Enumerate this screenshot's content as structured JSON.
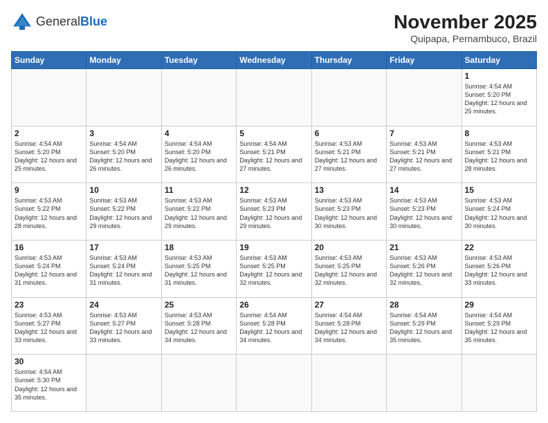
{
  "header": {
    "logo_general": "General",
    "logo_blue": "Blue",
    "month_title": "November 2025",
    "location": "Quipapa, Pernambuco, Brazil"
  },
  "days_of_week": [
    "Sunday",
    "Monday",
    "Tuesday",
    "Wednesday",
    "Thursday",
    "Friday",
    "Saturday"
  ],
  "weeks": [
    [
      {
        "day": "",
        "info": ""
      },
      {
        "day": "",
        "info": ""
      },
      {
        "day": "",
        "info": ""
      },
      {
        "day": "",
        "info": ""
      },
      {
        "day": "",
        "info": ""
      },
      {
        "day": "",
        "info": ""
      },
      {
        "day": "1",
        "info": "Sunrise: 4:54 AM\nSunset: 5:20 PM\nDaylight: 12 hours and 25 minutes."
      }
    ],
    [
      {
        "day": "2",
        "info": "Sunrise: 4:54 AM\nSunset: 5:20 PM\nDaylight: 12 hours and 25 minutes."
      },
      {
        "day": "3",
        "info": "Sunrise: 4:54 AM\nSunset: 5:20 PM\nDaylight: 12 hours and 26 minutes."
      },
      {
        "day": "4",
        "info": "Sunrise: 4:54 AM\nSunset: 5:20 PM\nDaylight: 12 hours and 26 minutes."
      },
      {
        "day": "5",
        "info": "Sunrise: 4:54 AM\nSunset: 5:21 PM\nDaylight: 12 hours and 27 minutes."
      },
      {
        "day": "6",
        "info": "Sunrise: 4:53 AM\nSunset: 5:21 PM\nDaylight: 12 hours and 27 minutes."
      },
      {
        "day": "7",
        "info": "Sunrise: 4:53 AM\nSunset: 5:21 PM\nDaylight: 12 hours and 27 minutes."
      },
      {
        "day": "8",
        "info": "Sunrise: 4:53 AM\nSunset: 5:21 PM\nDaylight: 12 hours and 28 minutes."
      }
    ],
    [
      {
        "day": "9",
        "info": "Sunrise: 4:53 AM\nSunset: 5:22 PM\nDaylight: 12 hours and 28 minutes."
      },
      {
        "day": "10",
        "info": "Sunrise: 4:53 AM\nSunset: 5:22 PM\nDaylight: 12 hours and 29 minutes."
      },
      {
        "day": "11",
        "info": "Sunrise: 4:53 AM\nSunset: 5:22 PM\nDaylight: 12 hours and 29 minutes."
      },
      {
        "day": "12",
        "info": "Sunrise: 4:53 AM\nSunset: 5:23 PM\nDaylight: 12 hours and 29 minutes."
      },
      {
        "day": "13",
        "info": "Sunrise: 4:53 AM\nSunset: 5:23 PM\nDaylight: 12 hours and 30 minutes."
      },
      {
        "day": "14",
        "info": "Sunrise: 4:53 AM\nSunset: 5:23 PM\nDaylight: 12 hours and 30 minutes."
      },
      {
        "day": "15",
        "info": "Sunrise: 4:53 AM\nSunset: 5:24 PM\nDaylight: 12 hours and 30 minutes."
      }
    ],
    [
      {
        "day": "16",
        "info": "Sunrise: 4:53 AM\nSunset: 5:24 PM\nDaylight: 12 hours and 31 minutes."
      },
      {
        "day": "17",
        "info": "Sunrise: 4:53 AM\nSunset: 5:24 PM\nDaylight: 12 hours and 31 minutes."
      },
      {
        "day": "18",
        "info": "Sunrise: 4:53 AM\nSunset: 5:25 PM\nDaylight: 12 hours and 31 minutes."
      },
      {
        "day": "19",
        "info": "Sunrise: 4:53 AM\nSunset: 5:25 PM\nDaylight: 12 hours and 32 minutes."
      },
      {
        "day": "20",
        "info": "Sunrise: 4:53 AM\nSunset: 5:25 PM\nDaylight: 12 hours and 32 minutes."
      },
      {
        "day": "21",
        "info": "Sunrise: 4:53 AM\nSunset: 5:26 PM\nDaylight: 12 hours and 32 minutes."
      },
      {
        "day": "22",
        "info": "Sunrise: 4:53 AM\nSunset: 5:26 PM\nDaylight: 12 hours and 33 minutes."
      }
    ],
    [
      {
        "day": "23",
        "info": "Sunrise: 4:53 AM\nSunset: 5:27 PM\nDaylight: 12 hours and 33 minutes."
      },
      {
        "day": "24",
        "info": "Sunrise: 4:53 AM\nSunset: 5:27 PM\nDaylight: 12 hours and 33 minutes."
      },
      {
        "day": "25",
        "info": "Sunrise: 4:53 AM\nSunset: 5:28 PM\nDaylight: 12 hours and 34 minutes."
      },
      {
        "day": "26",
        "info": "Sunrise: 4:54 AM\nSunset: 5:28 PM\nDaylight: 12 hours and 34 minutes."
      },
      {
        "day": "27",
        "info": "Sunrise: 4:54 AM\nSunset: 5:28 PM\nDaylight: 12 hours and 34 minutes."
      },
      {
        "day": "28",
        "info": "Sunrise: 4:54 AM\nSunset: 5:29 PM\nDaylight: 12 hours and 35 minutes."
      },
      {
        "day": "29",
        "info": "Sunrise: 4:54 AM\nSunset: 5:29 PM\nDaylight: 12 hours and 35 minutes."
      }
    ],
    [
      {
        "day": "30",
        "info": "Sunrise: 4:54 AM\nSunset: 5:30 PM\nDaylight: 12 hours and 35 minutes."
      },
      {
        "day": "",
        "info": ""
      },
      {
        "day": "",
        "info": ""
      },
      {
        "day": "",
        "info": ""
      },
      {
        "day": "",
        "info": ""
      },
      {
        "day": "",
        "info": ""
      },
      {
        "day": "",
        "info": ""
      }
    ]
  ]
}
